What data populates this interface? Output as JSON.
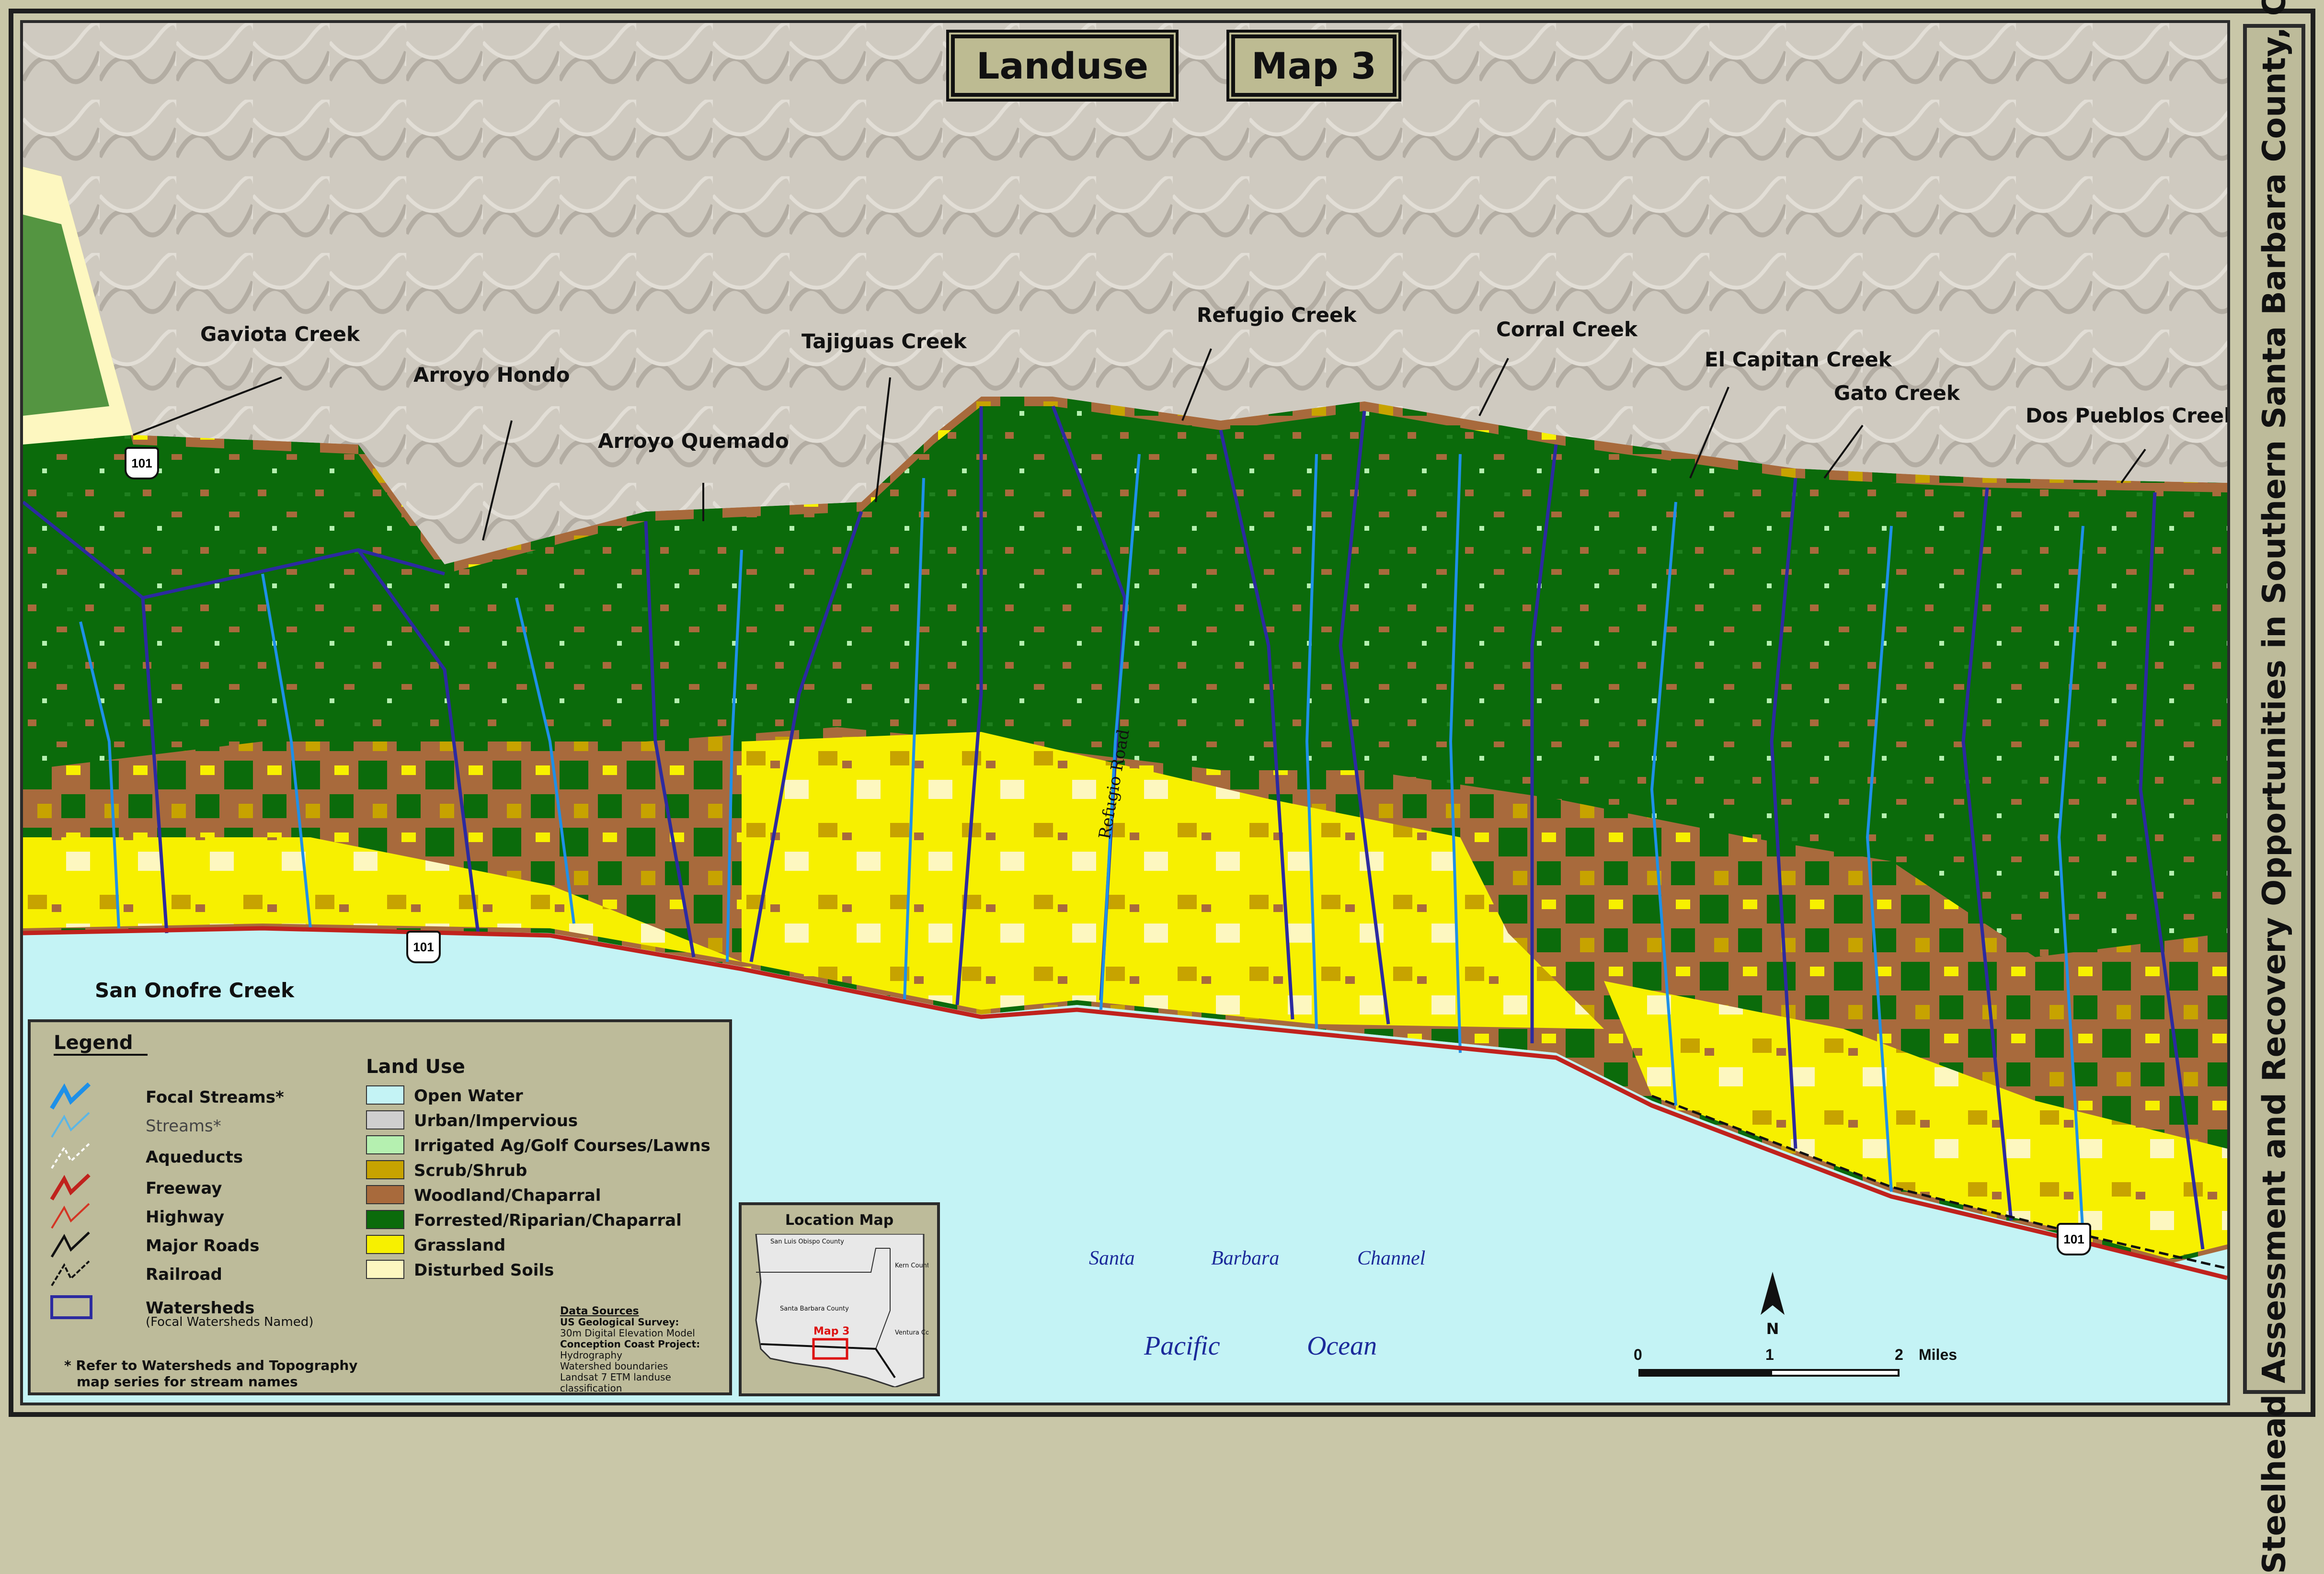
{
  "map": {
    "title": "Landuse",
    "map_number": "Map 3",
    "side_title": "Steelhead Assessment and Recovery Opportunities in Southern Santa Barbara County, California"
  },
  "creek_labels": [
    "Gaviota Creek",
    "Arroyo Hondo",
    "Arroyo Quemado",
    "Tajiguas Creek",
    "Refugio Creek",
    "Corral Creek",
    "El Capitan Creek",
    "Gato Creek",
    "Dos Pueblos Creek",
    "San Onofre Creek"
  ],
  "road_label": "Refugio Road",
  "highway_shield": "101",
  "water_labels": {
    "channel": [
      "Santa",
      "Barbara",
      "Channel"
    ],
    "ocean": [
      "Pacific",
      "Ocean"
    ]
  },
  "legend": {
    "title": "Legend",
    "line_items": [
      {
        "label": "Focal Streams*",
        "color": "#1e90e8",
        "icon": "focal-stream-icon"
      },
      {
        "label": "Streams*",
        "color": "#5bb6e6",
        "icon": "stream-icon"
      },
      {
        "label": "Aqueducts",
        "color": "#ffffff",
        "icon": "aqueduct-icon"
      },
      {
        "label": "Freeway",
        "color": "#c0221d",
        "icon": "freeway-icon"
      },
      {
        "label": "Highway",
        "color": "#d43524",
        "icon": "highway-icon"
      },
      {
        "label": "Major Roads",
        "color": "#111111",
        "icon": "major-road-icon"
      },
      {
        "label": "Railroad",
        "color": "#111111",
        "icon": "railroad-icon"
      },
      {
        "label": "Watersheds",
        "color": "#2c2aa0",
        "icon": "watershed-icon"
      }
    ],
    "watershed_note": "(Focal Watersheds Named)",
    "landuse_title": "Land Use",
    "landuse_items": [
      {
        "label": "Open Water",
        "color": "#c4f3f5"
      },
      {
        "label": "Urban/Impervious",
        "color": "#cfcfcf"
      },
      {
        "label": "Irrigated Ag/Golf Courses/Lawns",
        "color": "#b5f0b0"
      },
      {
        "label": "Scrub/Shrub",
        "color": "#c7a300"
      },
      {
        "label": "Woodland/Chaparral",
        "color": "#a86a3c"
      },
      {
        "label": "Forrested/Riparian/Chaparral",
        "color": "#0b6b0b"
      },
      {
        "label": "Grassland",
        "color": "#f7f000"
      },
      {
        "label": "Disturbed Soils",
        "color": "#fdf7c0"
      }
    ],
    "footnote": [
      "* Refer to Watersheds and Topography",
      "map series for stream names"
    ]
  },
  "data_sources": {
    "title": "Data Sources",
    "lines": [
      "US Geological Survey:",
      "30m Digital Elevation Model",
      "Conception Coast Project:",
      "Hydrography",
      "Watershed boundaries",
      "Landsat 7 ETM landuse classification"
    ]
  },
  "location_map": {
    "title": "Location Map",
    "counties": [
      "San Luis Obispo County",
      "Kern County",
      "Santa Barbara County",
      "Ventura County"
    ],
    "highlight": "Map 3"
  },
  "scale": {
    "ticks": [
      "0",
      "1",
      "2"
    ],
    "unit": "Miles"
  },
  "north_label": "N",
  "colors": {
    "ocean": "#c4f3f5",
    "hillshade": "#cbc6bd",
    "forest": "#0b6b0b",
    "woodland": "#a86a3c",
    "grassland": "#f7f000",
    "scrub": "#c7a300",
    "disturbed": "#fdf7c0",
    "watershed": "#2c2aa0",
    "stream": "#1e90e8",
    "freeway": "#c0221d"
  }
}
